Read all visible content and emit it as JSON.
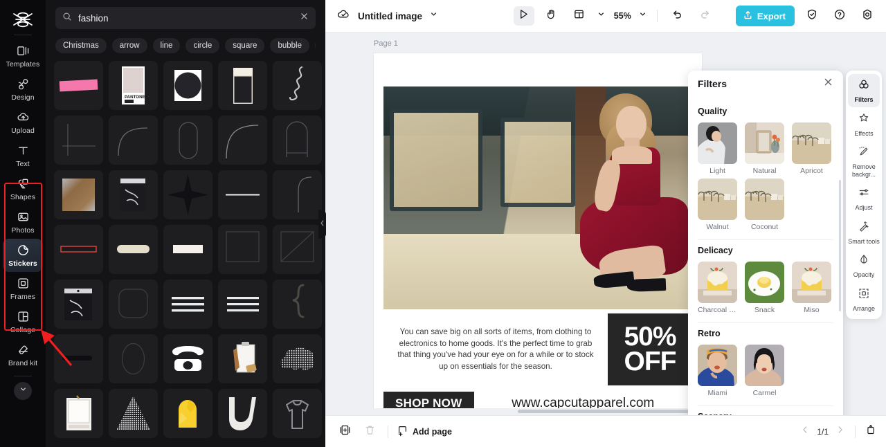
{
  "app": {
    "name": "CapCut Editor"
  },
  "left_rail": {
    "logo_icon": "capcut-logo-icon",
    "items": [
      {
        "label": "Templates",
        "icon": "templates-icon",
        "active": false
      },
      {
        "label": "Design",
        "icon": "design-icon",
        "active": false
      },
      {
        "label": "Upload",
        "icon": "upload-cloud-icon",
        "active": false
      },
      {
        "label": "Text",
        "icon": "text-icon",
        "active": false
      },
      {
        "label": "Shapes",
        "icon": "shapes-icon",
        "active": false
      },
      {
        "label": "Photos",
        "icon": "photos-icon",
        "active": false
      },
      {
        "label": "Stickers",
        "icon": "stickers-icon",
        "active": true
      },
      {
        "label": "Frames",
        "icon": "frames-icon",
        "active": false
      },
      {
        "label": "Collage",
        "icon": "collage-icon",
        "active": false
      },
      {
        "label": "Brand kit",
        "icon": "brand-kit-icon",
        "active": false
      }
    ],
    "expand_icon": "chevron-down-icon"
  },
  "search": {
    "value": "fashion",
    "placeholder": "Search stickers",
    "search_icon": "search-icon",
    "clear_icon": "close-icon"
  },
  "chips": [
    "Christmas",
    "arrow",
    "line",
    "circle",
    "square",
    "bubble",
    "plan"
  ],
  "sticker_grid": {
    "items": [
      "pink-washi-tape",
      "pantone-swatch-card",
      "black-circle-in-frame",
      "cream-notebook",
      "squiggle-line",
      "thin-cross-lines",
      "rounded-corner-curve",
      "outline-pill-shape",
      "arc-curve-line",
      "outline-arch-frame",
      "brown-gradient-square",
      "plastic-bag-photo",
      "black-four-point-star",
      "horizontal-white-line",
      "corner-arc-line",
      "red-outline-bar",
      "beige-rounded-bar",
      "cream-label-box",
      "thin-outline-square",
      "diagonal-crossed-square",
      "clear-zip-bag",
      "outline-rounded-square",
      "triple-stripe-lines",
      "triple-line-stack",
      "curly-brace",
      "dark-rounded-bar",
      "outline-ellipse",
      "retro-telephone",
      "clipboard-with-tag",
      "halftone-cloud-shape",
      "polaroid-frame",
      "halftone-triangle",
      "yellow-folded-shirt",
      "white-letter-u",
      "grey-tshirt-outline"
    ]
  },
  "panel": {
    "collapse_icon": "chevron-left-icon"
  },
  "annotation": {
    "box_color": "#f01f1f",
    "arrow_color": "#f01f1f"
  },
  "topbar": {
    "cloud_icon": "cloud-check-icon",
    "title": "Untitled image",
    "title_chevron": "chevron-down-icon",
    "select_tool_icon": "cursor-select-icon",
    "hand_tool_icon": "hand-pan-icon",
    "layout_icon": "layout-grid-icon",
    "layout_chevron": "chevron-down-icon",
    "zoom_level": "55%",
    "zoom_chevron": "chevron-down-icon",
    "undo_icon": "undo-icon",
    "redo_icon": "redo-icon",
    "export_label": "Export",
    "export_icon": "upload-share-icon",
    "export_color": "#2ac0e0",
    "shield_icon": "shield-check-icon",
    "help_icon": "help-circle-icon",
    "settings_icon": "gear-icon"
  },
  "canvas": {
    "page_label": "Page 1",
    "context_toolbar": {
      "crop_icon": "crop-icon",
      "replace_icon": "replace-shuffle-icon",
      "duplicate_icon": "duplicate-icon",
      "more_icon": "more-horizontal-icon"
    },
    "selection": {
      "color": "#00c8e0",
      "rotate_icon": "rotate-icon",
      "sticker_name": "pink-dress-on-hanger-sticker"
    },
    "design": {
      "body_text": "You can save big on all sorts of items, from clothing to electronics to home goods. It's the perfect time to grab that thing you've had your eye on for a while or to stock up on essentials for the season.",
      "discount_line1": "50%",
      "discount_line2": "OFF",
      "cta_label": "SHOP NOW",
      "website": "www.capcutapparel.com"
    }
  },
  "filters_panel": {
    "title": "Filters",
    "close_icon": "close-icon",
    "sections": [
      {
        "title": "Quality",
        "items": [
          {
            "name": "Light",
            "thumb": "woman-in-white-blouse"
          },
          {
            "name": "Natural",
            "thumb": "mirror-with-flowers"
          },
          {
            "name": "Apricot",
            "thumb": "desert-palm-village"
          },
          {
            "name": "Walnut",
            "thumb": "desert-palm-village"
          },
          {
            "name": "Coconut",
            "thumb": "desert-palm-village"
          }
        ]
      },
      {
        "title": "Delicacy",
        "items": [
          {
            "name": "Charcoal fir...",
            "thumb": "yellow-cake-slice"
          },
          {
            "name": "Snack",
            "thumb": "pastry-on-green-plate"
          },
          {
            "name": "Miso",
            "thumb": "yellow-cake-slice"
          }
        ]
      },
      {
        "title": "Retro",
        "items": [
          {
            "name": "Miami",
            "thumb": "woman-blue-blazer-headband"
          },
          {
            "name": "Carmel",
            "thumb": "woman-short-black-hair"
          }
        ]
      },
      {
        "title": "Scenery",
        "items": []
      }
    ]
  },
  "right_rail": {
    "items": [
      {
        "label": "Filters",
        "icon": "filters-circles-icon",
        "active": true
      },
      {
        "label": "Effects",
        "icon": "effects-sparkle-icon",
        "active": false
      },
      {
        "label": "Remove backgr...",
        "icon": "remove-background-icon",
        "active": false
      },
      {
        "label": "Adjust",
        "icon": "adjust-sliders-icon",
        "active": false
      },
      {
        "label": "Smart tools",
        "icon": "smart-tools-wand-icon",
        "active": false
      },
      {
        "label": "Opacity",
        "icon": "opacity-droplet-icon",
        "active": false
      },
      {
        "label": "Arrange",
        "icon": "arrange-icon",
        "active": false
      }
    ]
  },
  "bottombar": {
    "duplicate_page_icon": "duplicate-page-icon",
    "delete_page_icon": "trash-icon",
    "add_page_label": "Add page",
    "add_page_icon": "add-page-icon",
    "prev_icon": "chevron-left-icon",
    "page_indicator": "1/1",
    "next_icon": "chevron-right-icon",
    "fit_icon": "fit-page-icon"
  }
}
